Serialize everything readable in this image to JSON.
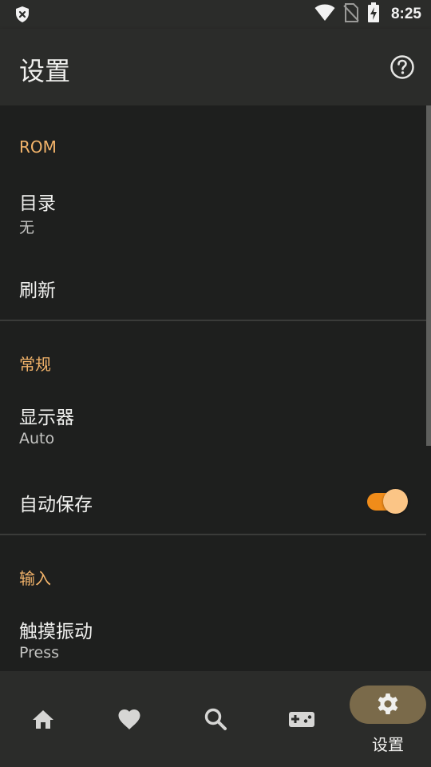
{
  "status_bar": {
    "time": "8:25",
    "icons": [
      "shield-x-icon",
      "wifi-icon",
      "no-sim-icon",
      "battery-charging-icon"
    ]
  },
  "app_bar": {
    "title": "设置",
    "help_icon": "help-circle-icon"
  },
  "sections": {
    "rom": {
      "header": "ROM",
      "directory": {
        "title": "目录",
        "value": "无"
      },
      "refresh": {
        "title": "刷新"
      }
    },
    "general": {
      "header": "常规",
      "display": {
        "title": "显示器",
        "value": "Auto"
      },
      "autosave": {
        "title": "自动保存",
        "enabled": true
      }
    },
    "input": {
      "header": "输入",
      "haptics": {
        "title": "触摸振动",
        "value": "Press"
      }
    }
  },
  "bottom_nav": {
    "items": [
      {
        "icon": "home-icon"
      },
      {
        "icon": "heart-icon"
      },
      {
        "icon": "search-icon"
      },
      {
        "icon": "gamepad-icon"
      },
      {
        "icon": "gear-icon",
        "label": "设置",
        "active": true
      }
    ]
  },
  "colors": {
    "accent": "#f2b36a",
    "toggle_track": "#f08c1a",
    "toggle_thumb": "#fbc586",
    "background": "#1e1f1e",
    "surface": "#2b2c2a",
    "active_pill": "#7a6a4a"
  }
}
